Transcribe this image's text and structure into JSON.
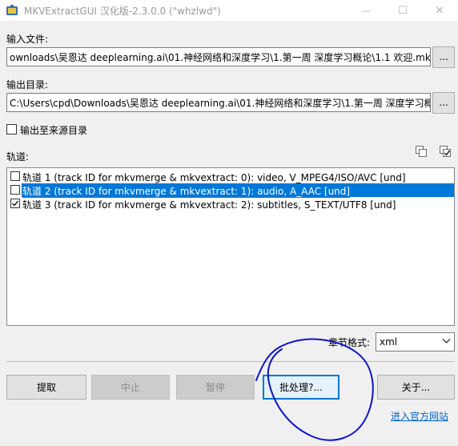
{
  "window": {
    "title": "MKVExtractGUI 汉化版-2.3.0.0 (\"whzlwd\")",
    "minimize_glyph": "—",
    "maximize_glyph": "☐",
    "close_glyph": "✕"
  },
  "input_file": {
    "label": "输入文件:",
    "value": "ownloads\\吴恩达 deeplearning.ai\\01.神经网络和深度学习\\1.第一周 深度学习概论\\1.1 欢迎.mkv",
    "browse_label": "..."
  },
  "output_dir": {
    "label": "输出目录:",
    "value": "C:\\Users\\cpd\\Downloads\\吴恩达 deeplearning.ai\\01.神经网络和深度学习\\1.第一周 深度学习概",
    "browse_label": "..."
  },
  "output_to_source": {
    "label": "输出至来源目录",
    "checked": false
  },
  "tracks": {
    "label": "轨道:",
    "items": [
      {
        "text": "轨道 1 (track ID for mkvmerge & mkvextract: 0): video, V_MPEG4/ISO/AVC [und]",
        "checked": false,
        "selected": false
      },
      {
        "text": "轨道 2 (track ID for mkvmerge & mkvextract: 1): audio, A_AAC [und]",
        "checked": false,
        "selected": true
      },
      {
        "text": "轨道 3 (track ID for mkvmerge & mkvextract: 2): subtitles, S_TEXT/UTF8 [und]",
        "checked": true,
        "selected": false
      }
    ]
  },
  "chapter_format": {
    "label": "章节格式:",
    "value": "xml"
  },
  "buttons": {
    "extract": "提取",
    "abort": "中止",
    "pause": "暂停",
    "batch": "批处理?...",
    "about": "关于..."
  },
  "link": {
    "official_site": "进入官方网站"
  },
  "colors": {
    "selection": "#0078d7",
    "link": "#0066cc",
    "annotation": "#0a14c8"
  }
}
